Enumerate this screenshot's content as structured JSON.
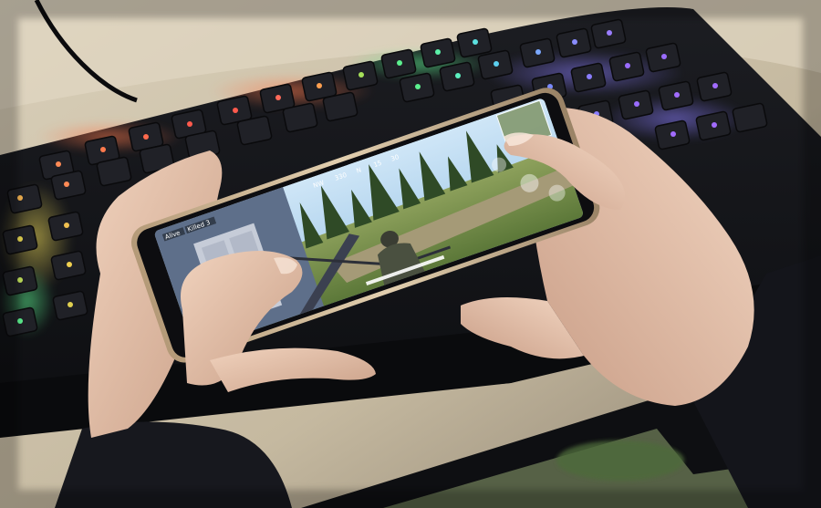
{
  "hud": {
    "alive_label": "Alive",
    "killed_label": "Killed 3",
    "compass_marks": [
      "NW",
      "330",
      "N",
      "15",
      "30"
    ]
  },
  "colors": {
    "desk": "#d7ccb6",
    "keyboard_body": "#141518",
    "key_glow_red": "#e2603e",
    "key_glow_green": "#4ad27a",
    "key_glow_cyan": "#52c7d9",
    "key_glow_blue": "#6670ff",
    "key_glow_purple": "#9a6cff",
    "key_glow_yellow": "#d7c64d",
    "phone_frame": "#c7b08c",
    "game_sky": "#a8d1ef",
    "game_grass": "#6f8a4a",
    "skin": "#e7c4ad",
    "sleeve": "#1a1b22"
  },
  "icons": [
    "keyboard",
    "smartphone",
    "hands",
    "game-scene",
    "trees",
    "soldier",
    "door",
    "action-buttons"
  ]
}
